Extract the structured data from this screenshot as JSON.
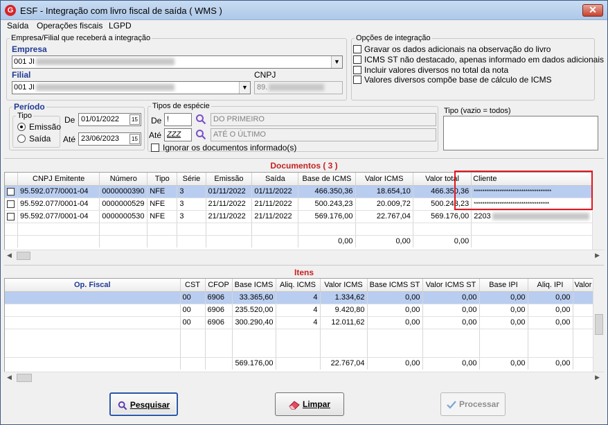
{
  "window": {
    "title": "ESF - Integração com livro fiscal de saída ( WMS )",
    "close_label": "✕"
  },
  "menu": [
    {
      "label": "Saída"
    },
    {
      "label": "Operações fiscais"
    },
    {
      "label": "LGPD"
    }
  ],
  "empresa_group": {
    "legend": "Empresa/Filial que receberá a integração",
    "empresa_label": "Empresa",
    "empresa_value": "001 JI",
    "filial_label": "Filial",
    "filial_value": "001 JI",
    "cnpj_label": "CNPJ",
    "cnpj_value": "89."
  },
  "opcoes_group": {
    "legend": "Opções de integração",
    "options": [
      {
        "label": "Gravar os dados adicionais na observação do livro",
        "checked": false
      },
      {
        "label": "ICMS ST  não destacado, apenas informado em dados adicionais",
        "checked": false
      },
      {
        "label": "Incluir valores diversos no total da nota",
        "checked": false
      },
      {
        "label": "Valores diversos compõe base de cálculo de ICMS",
        "checked": false
      }
    ]
  },
  "periodo_group": {
    "legend": "Período",
    "tipo_label": "Tipo",
    "radio_emissao": "Emissão",
    "radio_saida": "Saída",
    "selected": "Emissão",
    "de_label": "De",
    "de_value": "01/01/2022",
    "ate_label": "Até",
    "ate_value": "23/06/2023",
    "calendar_glyph": "15"
  },
  "especie_group": {
    "legend": "Tipos de espécie",
    "de_label": "De",
    "de_code": "!",
    "de_desc": "DO PRIMEIRO",
    "ate_label": "Até",
    "ate_code": "ZZZ",
    "ate_desc": "ATÉ O ÚLTIMO",
    "ignorar_label": "Ignorar os documentos informado(s)"
  },
  "tipo_box": {
    "label": "Tipo (vazio = todos)",
    "value": ""
  },
  "documentos": {
    "header": "Documentos ( 3 )",
    "columns": [
      "",
      "CNPJ Emitente",
      "Número",
      "Tipo",
      "Série",
      "Emissão",
      "Saída",
      "Base de ICMS",
      "Valor ICMS",
      "Valor total",
      "Cliente"
    ],
    "rows": [
      {
        "cnpj": "95.592.077/0001-04",
        "numero": "0000000390",
        "tipo": "NFE",
        "serie": "3",
        "emissao": "01/11/2022",
        "saida": "01/11/2022",
        "base": "466.350,36",
        "icms": "18.654,10",
        "total": "466.350,36",
        "cliente": "************************************",
        "selected": true
      },
      {
        "cnpj": "95.592.077/0001-04",
        "numero": "0000000529",
        "tipo": "NFE",
        "serie": "3",
        "emissao": "21/11/2022",
        "saida": "21/11/2022",
        "base": "500.243,23",
        "icms": "20.009,72",
        "total": "500.243,23",
        "cliente": "***********************************",
        "selected": false
      },
      {
        "cnpj": "95.592.077/0001-04",
        "numero": "0000000530",
        "tipo": "NFE",
        "serie": "3",
        "emissao": "21/11/2022",
        "saida": "21/11/2022",
        "base": "569.176,00",
        "icms": "22.767,04",
        "total": "569.176,00",
        "cliente": "2203",
        "selected": false
      }
    ],
    "totals": {
      "base": "0,00",
      "icms": "0,00",
      "total": "0,00"
    }
  },
  "itens": {
    "header": "Itens",
    "columns": [
      "Op. Fiscal",
      "CST",
      "CFOP",
      "Base ICMS",
      "Aliq. ICMS",
      "Valor ICMS",
      "Base ICMS ST",
      "Valor ICMS ST",
      "Base IPI",
      "Aliq. IPI",
      "Valor"
    ],
    "rows": [
      {
        "op": "",
        "cst": "00",
        "cfop": "6906",
        "base": "33.365,60",
        "aliq": "4",
        "icms": "1.334,62",
        "base_st": "0,00",
        "icms_st": "0,00",
        "base_ipi": "0,00",
        "aliq_ipi": "0,00",
        "selected": true
      },
      {
        "op": "",
        "cst": "00",
        "cfop": "6906",
        "base": "235.520,00",
        "aliq": "4",
        "icms": "9.420,80",
        "base_st": "0,00",
        "icms_st": "0,00",
        "base_ipi": "0,00",
        "aliq_ipi": "0,00",
        "selected": false
      },
      {
        "op": "",
        "cst": "00",
        "cfop": "6906",
        "base": "300.290,40",
        "aliq": "4",
        "icms": "12.011,62",
        "base_st": "0,00",
        "icms_st": "0,00",
        "base_ipi": "0,00",
        "aliq_ipi": "0,00",
        "selected": false
      }
    ],
    "totals": {
      "base": "569.176,00",
      "icms": "22.767,04",
      "base_st": "0,00",
      "icms_st": "0,00",
      "base_ipi": "0,00",
      "aliq_ipi": "0,00"
    }
  },
  "buttons": {
    "pesquisar": "Pesquisar",
    "limpar": "Limpar",
    "processar": "Processar"
  },
  "colors": {
    "highlight": "#e3151f",
    "header_red": "#c62020",
    "selection": "#b9cdf0"
  }
}
